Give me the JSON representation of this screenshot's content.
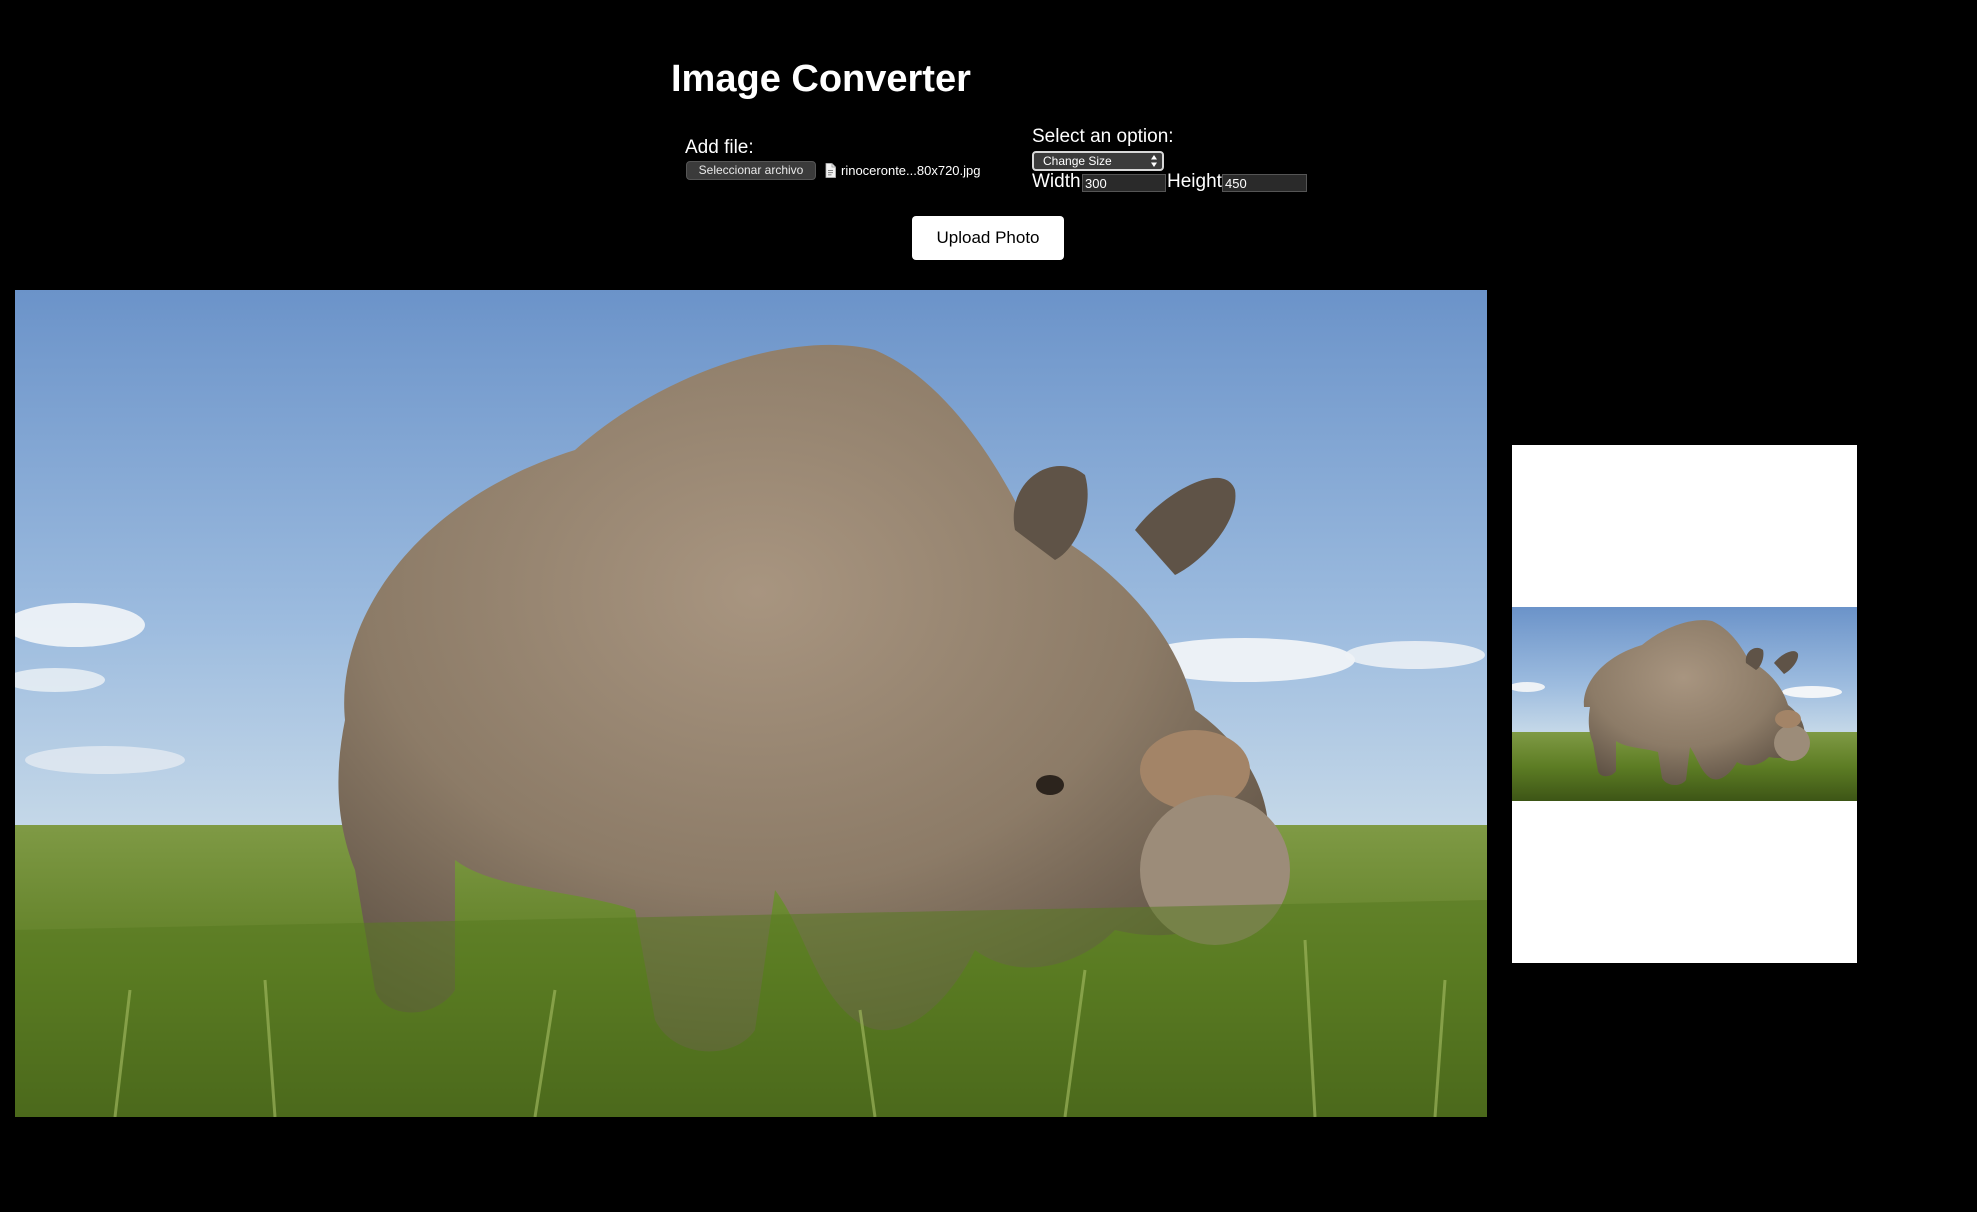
{
  "page": {
    "title": "Image Converter"
  },
  "add_file": {
    "label": "Add file:",
    "button_label": "Seleccionar archivo",
    "file_name": "rinoceronte...80x720.jpg"
  },
  "options": {
    "label": "Select an option:",
    "selected_value": "Change Size",
    "width_label": "Width",
    "width_value": "300",
    "height_label": "Height",
    "height_value": "450"
  },
  "upload": {
    "button_label": "Upload Photo"
  },
  "images": {
    "main_photo_subject": "white rhino grazing in grassland under blue sky",
    "preview_subject": "resized rhino photo, letterboxed on white"
  },
  "colors": {
    "background": "#000000",
    "text": "#ffffff",
    "upload_button_bg": "#ffffff",
    "preview_bg": "#ffffff",
    "sky": "#6f98cf",
    "grass": "#6a8a2e",
    "rhino": "#8f7f6c"
  }
}
